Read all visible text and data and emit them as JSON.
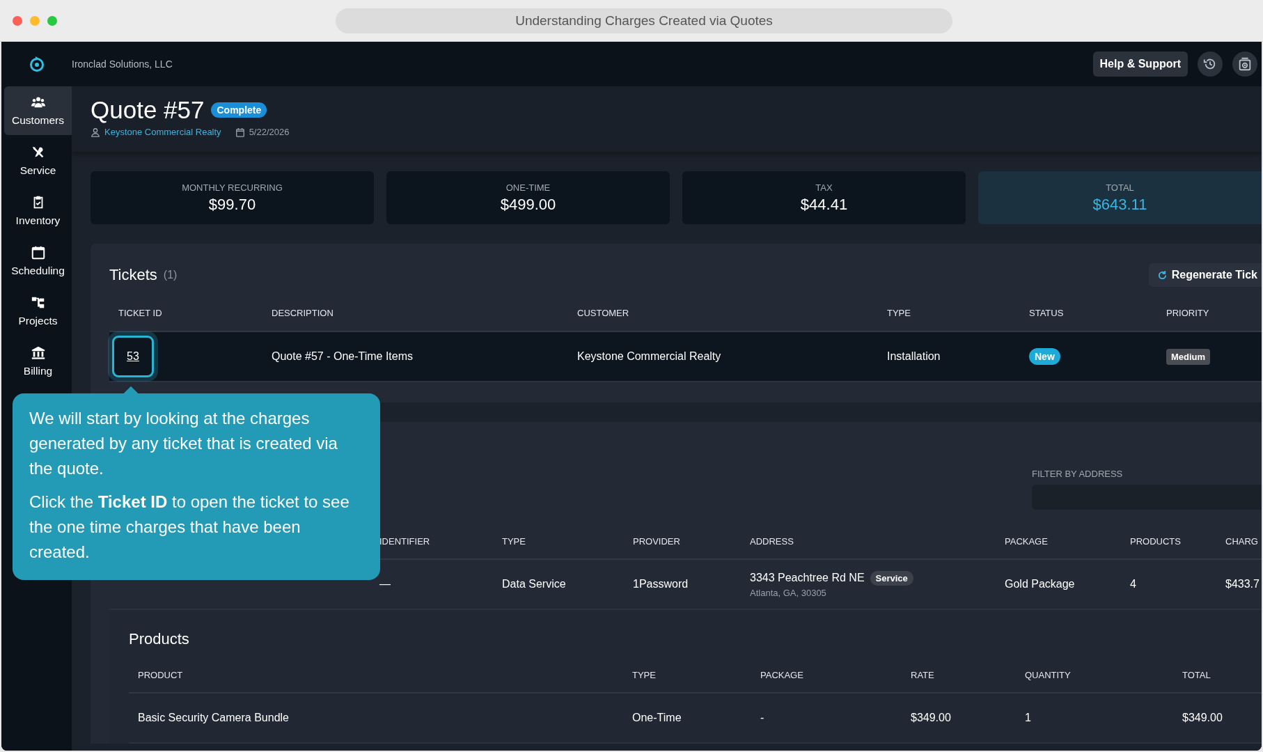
{
  "window": {
    "title": "Understanding Charges Created via Quotes"
  },
  "topbar": {
    "company": "Ironclad Solutions, LLC",
    "help_button": "Help & Support"
  },
  "sidebar": {
    "items": [
      {
        "label": "Customers",
        "kind": "customers",
        "selected": true
      },
      {
        "label": "Service",
        "kind": "service",
        "selected": false
      },
      {
        "label": "Inventory",
        "kind": "inventory",
        "selected": false
      },
      {
        "label": "Scheduling",
        "kind": "scheduling",
        "selected": false
      },
      {
        "label": "Projects",
        "kind": "projects",
        "selected": false
      },
      {
        "label": "Billing",
        "kind": "billing",
        "selected": false
      }
    ]
  },
  "quote": {
    "title": "Quote #57",
    "status": "Complete",
    "customer": "Keystone Commercial Realty",
    "date": "5/22/2026"
  },
  "totals": [
    {
      "label": "MONTHLY RECURRING",
      "value": "$99.70",
      "highlighted": false
    },
    {
      "label": "ONE-TIME",
      "value": "$499.00",
      "highlighted": false
    },
    {
      "label": "TAX",
      "value": "$44.41",
      "highlighted": false
    },
    {
      "label": "TOTAL",
      "value": "$643.11",
      "highlighted": true
    }
  ],
  "tickets": {
    "title": "Tickets",
    "count": "(1)",
    "regenerate_button": "Regenerate Tick",
    "columns": [
      "TICKET ID",
      "DESCRIPTION",
      "CUSTOMER",
      "TYPE",
      "STATUS",
      "PRIORITY"
    ],
    "rows": [
      {
        "ticket_id": "53",
        "description": "Quote #57 - One-Time Items",
        "customer": "Keystone Commercial Realty",
        "type": "Installation",
        "status": "New",
        "priority": "Medium",
        "focused": true
      }
    ]
  },
  "services": {
    "filter": {
      "label": "FILTER BY ADDRESS"
    },
    "columns": [
      "IDENTIFIER",
      "TYPE",
      "PROVIDER",
      "ADDRESS",
      "PACKAGE",
      "PRODUCTS",
      "CHARG"
    ],
    "rows": [
      {
        "identifier": "—",
        "type": "Data Service",
        "provider": "1Password",
        "address": "3343 Peachtree Rd NE",
        "address_tag": "Service",
        "address_line_2": "Atlanta, GA, 30305",
        "package": "Gold Package",
        "products": "4",
        "charge": "$433.7"
      }
    ]
  },
  "products": {
    "title": "Products",
    "columns": [
      "PRODUCT",
      "TYPE",
      "PACKAGE",
      "RATE",
      "QUANTITY",
      "TOTAL"
    ],
    "rows": [
      {
        "product": "Basic Security Camera Bundle",
        "type": "One-Time",
        "package": "-",
        "rate": "$349.00",
        "quantity": "1",
        "total": "$349.00"
      }
    ]
  },
  "tooltip": {
    "paragraphs": [
      "We will start by looking at the charges generated by any ticket that is created via the quote.",
      "Click the **Ticket ID** to open the ticket to see the one time charges that have been created."
    ]
  }
}
